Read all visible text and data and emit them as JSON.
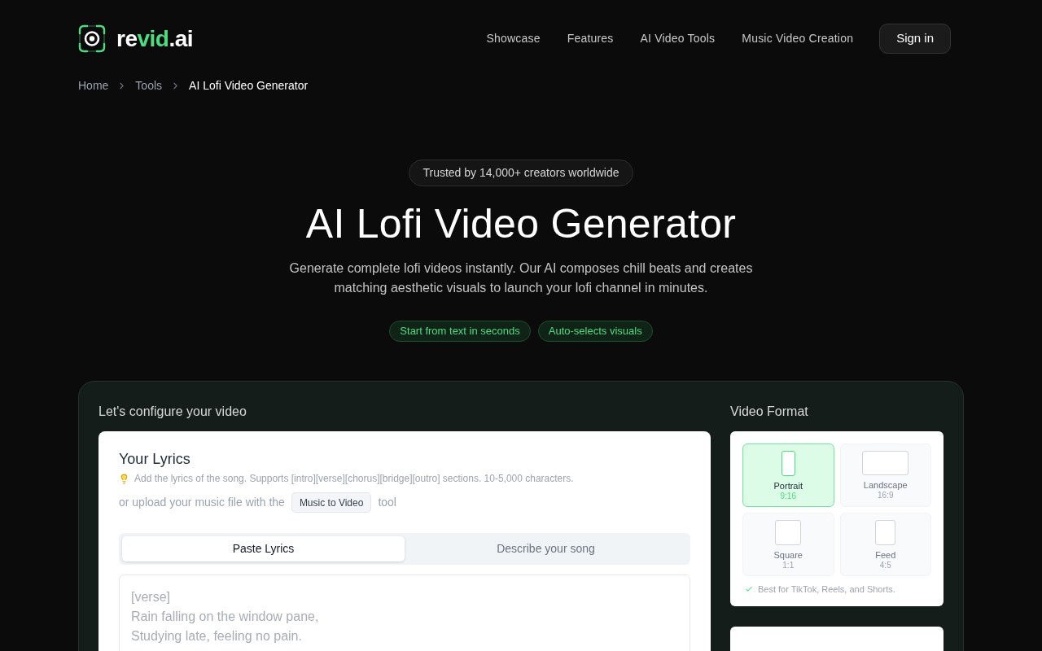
{
  "header": {
    "logo": {
      "parts": [
        {
          "text": "re",
          "accent": false
        },
        {
          "text": "vid",
          "accent": true
        },
        {
          "text": ".ai",
          "accent": false
        }
      ]
    },
    "nav": [
      "Showcase",
      "Features",
      "AI Video Tools",
      "Music Video Creation"
    ],
    "sign_in": "Sign in"
  },
  "breadcrumb": [
    {
      "label": "Home",
      "current": false
    },
    {
      "label": "Tools",
      "current": false
    },
    {
      "label": "AI Lofi Video Generator",
      "current": true
    }
  ],
  "hero": {
    "badge": "Trusted by 14,000+ creators worldwide",
    "title": "AI Lofi Video Generator",
    "subtitle": "Generate complete lofi videos instantly. Our AI composes chill beats and creates matching aesthetic visuals to launch your lofi channel in minutes.",
    "chips": [
      "Start from text in seconds",
      "Auto-selects visuals"
    ]
  },
  "configurator": {
    "heading": "Let's configure your video",
    "lyrics": {
      "title": "Your Lyrics",
      "hint": "Add the lyrics of the song. Supports [intro][verse][chorus][bridge][outro] sections. 10-5,000 characters.",
      "upload_prefix": "or upload your music file with the",
      "upload_button": "Music to Video",
      "upload_suffix": "tool",
      "tabs": [
        {
          "label": "Paste Lyrics",
          "selected": true
        },
        {
          "label": "Describe your song",
          "selected": false
        }
      ],
      "placeholder": "[verse]\nRain falling on the window pane,\nStudying late, feeling no pain."
    }
  },
  "video_format": {
    "heading": "Video Format",
    "options": [
      {
        "kind": "portrait",
        "label": "Portrait",
        "ratio": "9:16",
        "selected": true
      },
      {
        "kind": "landscape",
        "label": "Landscape",
        "ratio": "16:9",
        "selected": false
      },
      {
        "kind": "square",
        "label": "Square",
        "ratio": "1:1",
        "selected": false
      },
      {
        "kind": "feed",
        "label": "Feed",
        "ratio": "4:5",
        "selected": false
      }
    ],
    "note": "Best for TikTok, Reels, and Shorts."
  }
}
